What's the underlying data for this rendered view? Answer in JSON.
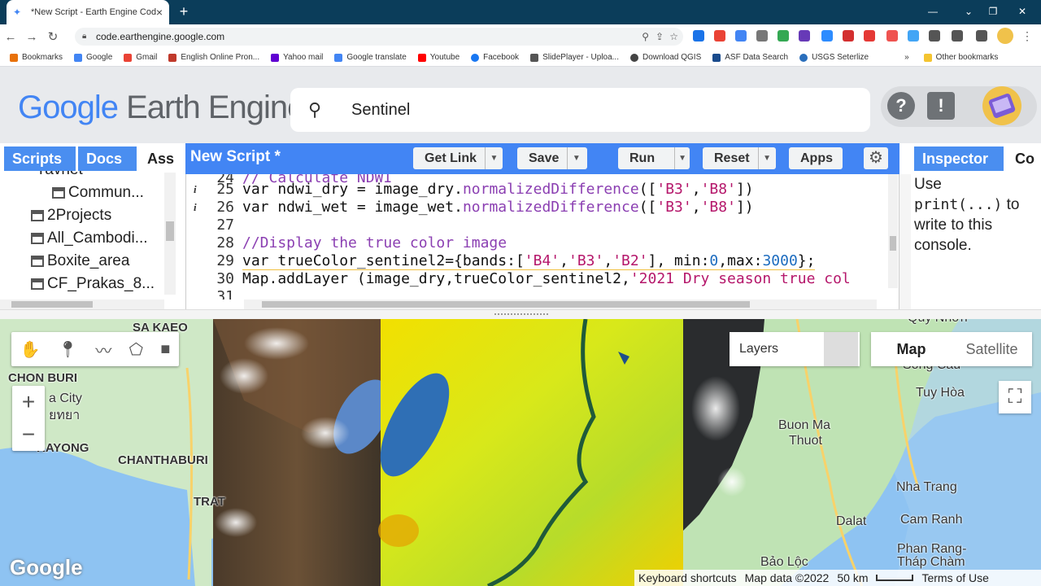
{
  "browser": {
    "tab_title": "*New Script - Earth Engine Code",
    "new_tab": "+",
    "url": "code.earthengine.google.com",
    "bookmarks": [
      {
        "label": "Bookmarks",
        "color": "#e8710a"
      },
      {
        "label": "Google",
        "color": "#4285f4"
      },
      {
        "label": "Gmail",
        "color": "#ea4335"
      },
      {
        "label": "English Online Pron...",
        "color": "#c0392b"
      },
      {
        "label": "Yahoo mail",
        "color": "#6001d2"
      },
      {
        "label": "Google translate",
        "color": "#4285f4"
      },
      {
        "label": "Youtube",
        "color": "#ff0000"
      },
      {
        "label": "Facebook",
        "color": "#1877f2"
      },
      {
        "label": "SlidePlayer - Uploa...",
        "color": "#555555"
      },
      {
        "label": "Download QGIS",
        "color": "#444444"
      },
      {
        "label": "ASF Data Search",
        "color": "#1a4b8c"
      },
      {
        "label": "USGS Seterlize",
        "color": "#2a6ebb"
      }
    ],
    "more_bookmarks": "»",
    "other_bookmarks": "Other bookmarks"
  },
  "gee": {
    "logo_google": "Google",
    "logo_product": "Earth Engine",
    "search_value": "Sentinel",
    "left_tabs": [
      "Scripts",
      "Docs",
      "Ass"
    ],
    "tree": [
      "Yavnet",
      "Commun...",
      "2Projects",
      "All_Cambodi...",
      "Boxite_area",
      "CF_Prakas_8..."
    ],
    "editor_title": "New Script *",
    "buttons": {
      "get_link": "Get Link",
      "save": "Save",
      "run": "Run",
      "reset": "Reset",
      "apps": "Apps"
    },
    "right_tabs": [
      "Inspector",
      "Co"
    ],
    "console_text_1": "Use",
    "console_code": "print(...)",
    "console_text_2": "to write to this console."
  },
  "code_lines": [
    {
      "num": "24",
      "info": false
    },
    {
      "num": "25",
      "info": true
    },
    {
      "num": "26",
      "info": true
    },
    {
      "num": "27",
      "info": false
    },
    {
      "num": "28",
      "info": false
    },
    {
      "num": "29",
      "info": false
    },
    {
      "num": "30",
      "info": false
    },
    {
      "num": "31",
      "info": false
    }
  ],
  "code": {
    "l24": "// Calculate NDWI",
    "l25_a": "var ndwi_dry = image_dry.",
    "l25_fn": "normalizedDifference",
    "l25_b": "([",
    "l25_s1": "'B3'",
    "l25_c": ",",
    "l25_s2": "'B8'",
    "l25_d": "])",
    "l26_a": "var ndwi_wet = image_wet.",
    "l26_fn": "normalizedDifference",
    "l26_b": "([",
    "l26_s1": "'B3'",
    "l26_c": ",",
    "l26_s2": "'B8'",
    "l26_d": "])",
    "l28": "//Display the true color image",
    "l29_a": "var trueColor_sentinel2={bands:[",
    "l29_s1": "'B4'",
    "l29_s2": "'B3'",
    "l29_s3": "'B2'",
    "l29_b": "], min:",
    "l29_n1": "0",
    "l29_c": ",max:",
    "l29_n2": "3000",
    "l29_d": "};",
    "l30_a": "Map.addLayer (image_dry,trueColor_sentinel2,",
    "l30_s": "'2021 Dry season true col"
  },
  "map": {
    "labels": [
      "SA KAEO",
      "CHON BURI",
      "a City",
      "ยทยา",
      "RAYONG",
      "CHANTHABURI",
      "TRAT",
      "Quy Nhơn",
      "Sông Cầu",
      "Tuy Hòa",
      "Buon Ma",
      "Thuot",
      "Nha Trang",
      "Cam Ranh",
      "Dalat",
      "Phan Rang-",
      "Tháp Chàm",
      "Bảo Lộc"
    ],
    "layers_label": "Layers",
    "map_button": "Map",
    "satellite_button": "Satellite",
    "zoom_in": "+",
    "zoom_out": "−",
    "google_logo": "Google",
    "attribution": [
      "Keyboard shortcuts",
      "Map data ©2022",
      "50 km",
      "Terms of Use"
    ]
  },
  "colors": {
    "accent": "#4285f4",
    "tab_bar": "#0b3d5a"
  }
}
